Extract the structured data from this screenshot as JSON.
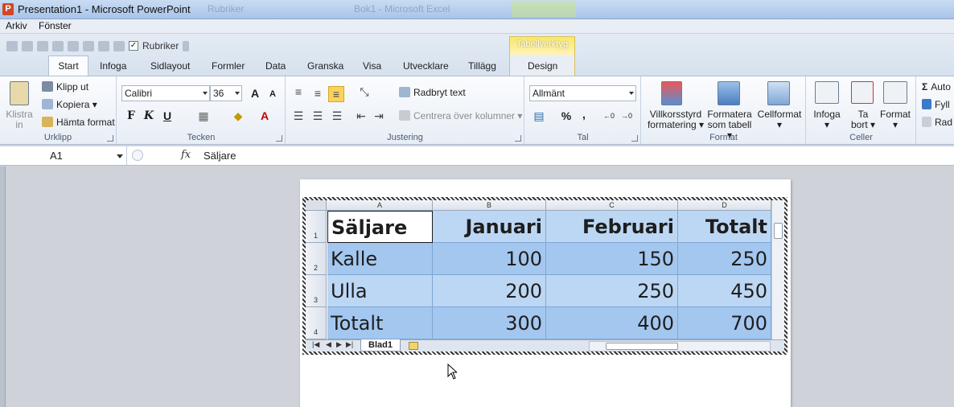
{
  "window": {
    "app_icon": "P",
    "title": "Presentation1 - Microsoft PowerPoint",
    "ghost_left": "Rubriker",
    "ghost_middle": "Bok1 - Microsoft Excel"
  },
  "menubar": {
    "items": [
      "Arkiv",
      "Fönster"
    ]
  },
  "qat": {
    "checkbox_label": "Rubriker",
    "checked": true
  },
  "contextual_tab_group": "Tabellverktyg",
  "tabs": [
    "Start",
    "Infoga",
    "Sidlayout",
    "Formler",
    "Data",
    "Granska",
    "Visa",
    "Utvecklare",
    "Tillägg",
    "Design"
  ],
  "ribbon": {
    "clipboard": {
      "label": "Urklipp",
      "paste": [
        "Klistra",
        "in"
      ],
      "cut": "Klipp ut",
      "copy": "Kopiera",
      "format_painter": "Hämta format"
    },
    "font": {
      "label": "Tecken",
      "font_name": "Calibri",
      "font_size": "36",
      "bold": "F",
      "italic": "K",
      "underline": "U"
    },
    "alignment": {
      "label": "Justering",
      "wrap_text": "Radbryt text",
      "merge_center": "Centrera över kolumner"
    },
    "number": {
      "label": "Tal",
      "format": "Allmänt",
      "percent": "%",
      "comma": ","
    },
    "styles": {
      "label": "Format",
      "conditional": [
        "Villkorsstyrd",
        "formatering"
      ],
      "format_as_table": [
        "Formatera",
        "som tabell"
      ],
      "cell_styles": "Cellformat"
    },
    "cells": {
      "label": "Celler",
      "insert": "Infoga",
      "delete": [
        "Ta",
        "bort"
      ],
      "format": "Format"
    },
    "editing": {
      "autosum": "Auto",
      "fill": "Fyll",
      "clear": "Rad"
    }
  },
  "formula_bar": {
    "name_box": "A1",
    "fx": "fx",
    "value": "Säljare"
  },
  "sheet": {
    "columns": [
      "A",
      "B",
      "C",
      "D"
    ],
    "rows": [
      "1",
      "2",
      "3",
      "4"
    ],
    "header": [
      "Säljare",
      "Januari",
      "Februari",
      "Totalt"
    ],
    "data": [
      [
        "Kalle",
        "100",
        "150",
        "250"
      ],
      [
        "Ulla",
        "200",
        "250",
        "450"
      ],
      [
        "Totalt",
        "300",
        "400",
        "700"
      ]
    ],
    "tab_name": "Blad1",
    "colors": {
      "header_fill": "#bcd7f4",
      "row_fill": "#a4c7ef",
      "grid": "#7fa6d3"
    }
  }
}
